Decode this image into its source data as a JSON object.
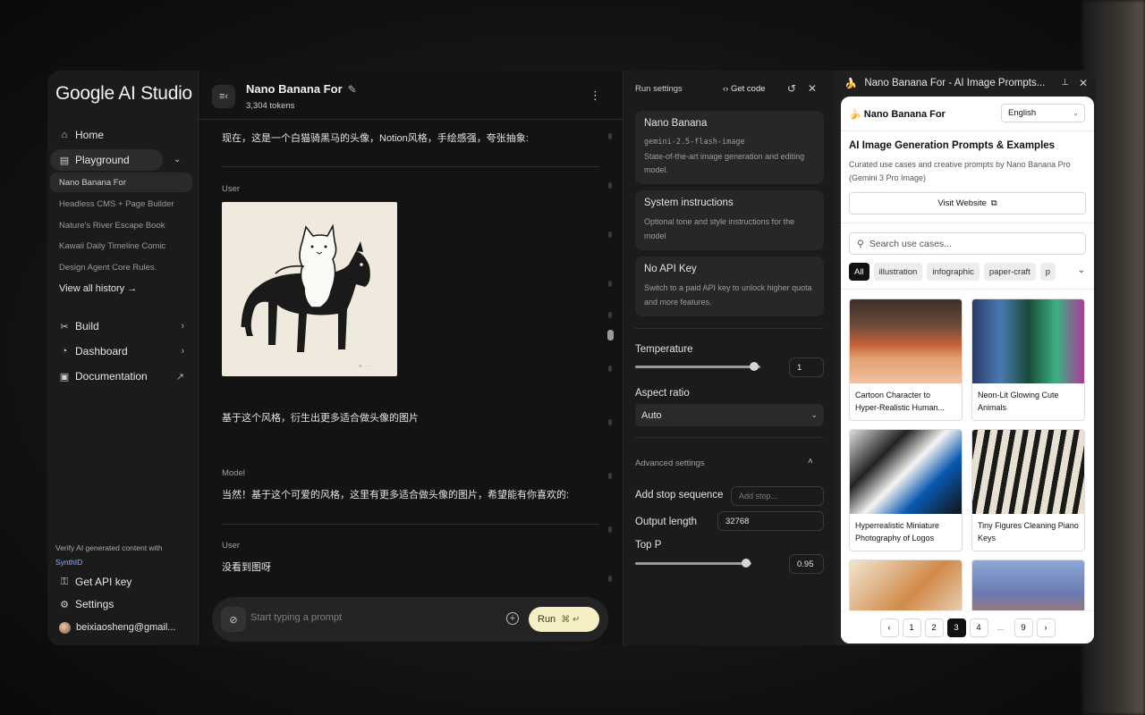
{
  "sidebar": {
    "logo": "Google AI Studio",
    "home": "Home",
    "playground": "Playground",
    "history": [
      "Nano Banana For",
      "Headless CMS + Page Builder",
      "Nature's River Escape Book",
      "Kawaii Daily Timeline Comic",
      "Design Agent Core Rules."
    ],
    "view_all": "View all history →",
    "build": "Build",
    "dashboard": "Dashboard",
    "documentation": "Documentation",
    "verify_text": "Verify AI generated content with",
    "verify_link": "SynthID",
    "get_api_key": "Get API key",
    "settings": "Settings",
    "user_email": "beixiaosheng@gmail..."
  },
  "chat": {
    "title": "Nano Banana For",
    "tokens": "3,304 tokens",
    "messages": [
      {
        "role": "",
        "text": "现在，这是一个白猫骑黑马的头像，Notion风格，手绘感强，夸张抽象:"
      },
      {
        "role": "User",
        "text": "基于这个风格，衍生出更多适合做头像的图片"
      },
      {
        "role": "Model",
        "text": "当然！基于这个可爱的风格，这里有更多适合做头像的图片，希望能有你喜欢的:"
      },
      {
        "role": "User",
        "text": "没看到图呀"
      }
    ],
    "prompt_placeholder": "Start typing a prompt",
    "run_label": "Run",
    "run_shortcut": "⌘ ↵"
  },
  "settings": {
    "title": "Run settings",
    "get_code": "Get code",
    "model": {
      "name": "Nano Banana",
      "id": "gemini-2.5-flash-image",
      "desc": "State-of-the-art image generation and editing model."
    },
    "system_instructions": {
      "title": "System instructions",
      "desc": "Optional tone and style instructions for the model"
    },
    "api_key": {
      "title": "No API Key",
      "desc": "Switch to a paid API key to unlock higher quota and more features."
    },
    "temperature_label": "Temperature",
    "temperature_value": "1",
    "temperature_fraction": 0.95,
    "aspect_label": "Aspect ratio",
    "aspect_value": "Auto",
    "advanced_label": "Advanced settings",
    "stop_label": "Add stop sequence",
    "stop_placeholder": "Add stop...",
    "output_label": "Output length",
    "output_value": "32768",
    "topp_label": "Top P",
    "topp_value": "0.95",
    "topp_fraction": 0.95
  },
  "extension": {
    "window_title": "Nano Banana For - AI Image Prompts...",
    "brand": "Nano Banana For",
    "language": "English",
    "heading": "AI Image Generation Prompts & Examples",
    "description": "Curated use cases and creative prompts by Nano Banana Pro (Gemini 3 Pro Image)",
    "visit_label": "Visit Website",
    "search_placeholder": "Search use cases...",
    "chips": [
      "All",
      "illustration",
      "infographic",
      "paper-craft",
      "p"
    ],
    "cards": [
      {
        "caption": "Cartoon Character to Hyper-Realistic Human..."
      },
      {
        "caption": "Neon-Lit Glowing Cute Animals"
      },
      {
        "caption": "Hyperrealistic Miniature Photography of Logos"
      },
      {
        "caption": "Tiny Figures Cleaning Piano Keys"
      }
    ],
    "pages": [
      "1",
      "2",
      "3",
      "4",
      "...",
      "9"
    ],
    "active_page": "3"
  },
  "colors": {
    "run_button": "#f7efc4",
    "active_page": "#111111"
  }
}
